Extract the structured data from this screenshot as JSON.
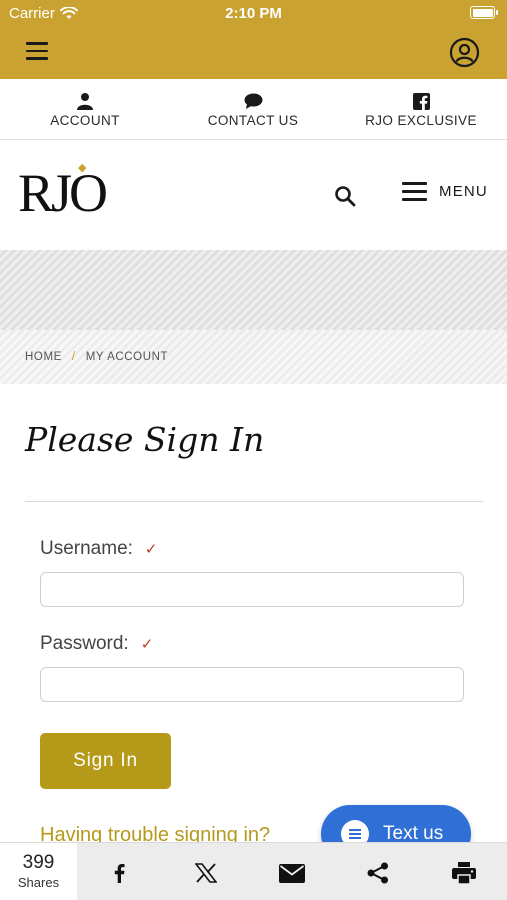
{
  "status": {
    "carrier": "Carrier",
    "time": "2:10 PM"
  },
  "quick_links": [
    {
      "label": "ACCOUNT",
      "icon": "person-icon"
    },
    {
      "label": "CONTACT US",
      "icon": "chat-bubble-icon"
    },
    {
      "label": "RJO EXCLUSIVE",
      "icon": "facebook-icon"
    }
  ],
  "header": {
    "logo_text": "RJO",
    "menu_label": "MENU"
  },
  "breadcrumb": {
    "home": "HOME",
    "separator": "/",
    "current": "MY ACCOUNT"
  },
  "signin": {
    "title": "Please Sign In",
    "username_label": "Username:",
    "password_label": "Password:",
    "required_mark": "✓",
    "username_value": "",
    "password_value": "",
    "button_label": "Sign In",
    "trouble_link": "Having trouble signing in?"
  },
  "chat": {
    "label": "Text us"
  },
  "share_bar": {
    "count": "399",
    "label": "Shares",
    "icons": [
      "facebook-icon",
      "x-icon",
      "email-icon",
      "share-icon",
      "print-icon"
    ]
  },
  "colors": {
    "brand_gold": "#c9a231",
    "button_gold": "#b59a1a",
    "chat_blue": "#2f6fd6",
    "required_red": "#c0392b"
  }
}
